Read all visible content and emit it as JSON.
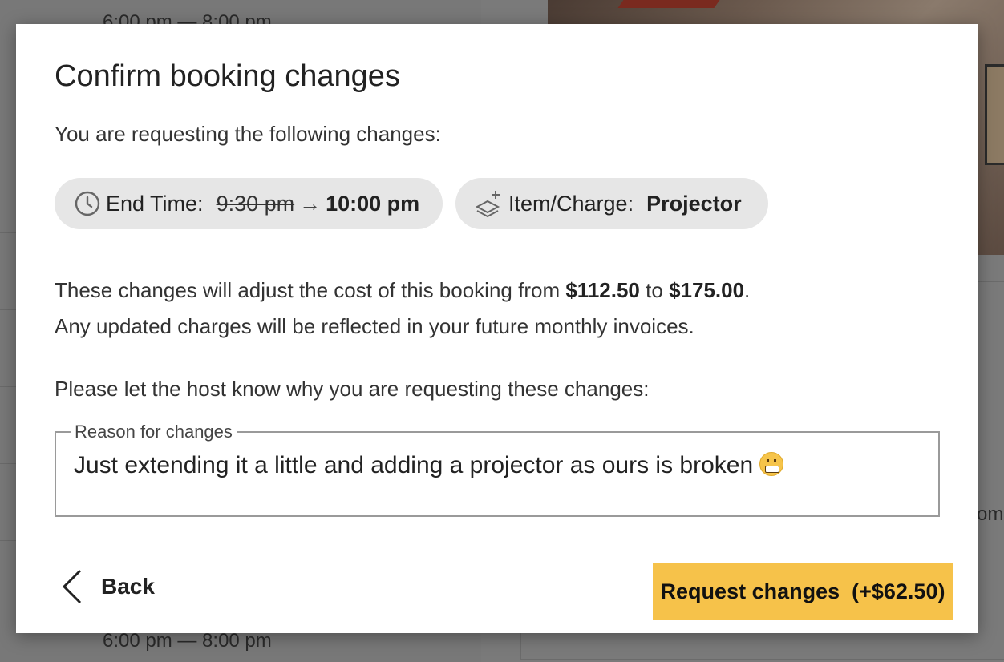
{
  "background": {
    "time_top": "6:00 pm — 8:00 pm",
    "time_bottom": "6:00 pm — 8:00 pm",
    "right_fragment": "om"
  },
  "modal": {
    "title": "Confirm booking changes",
    "subtitle": "You are requesting the following changes:",
    "changes": [
      {
        "icon": "clock-icon",
        "label": "End Time:",
        "old_value": "9:30 pm",
        "arrow": "→",
        "new_value": "10:00 pm"
      },
      {
        "icon": "layers-add-icon",
        "label": "Item/Charge:",
        "new_value": "Projector"
      }
    ],
    "cost": {
      "prefix": "These changes will adjust the cost of this booking from",
      "from": "$112.50",
      "middle": "to",
      "to": "$175.00",
      "suffix": ".",
      "note": "Any updated charges will be reflected in your future monthly invoices."
    },
    "prompt": "Please let the host know why you are requesting these changes:",
    "reason_field": {
      "label": "Reason for changes",
      "value": "Just extending it a little and adding a projector as ours is broken"
    },
    "back_label": "Back",
    "request_label": "Request changes  (+$62.50)"
  },
  "colors": {
    "primary_button": "#f6c24a",
    "chip_background": "#e6e6e6",
    "overlay": "#787878"
  }
}
